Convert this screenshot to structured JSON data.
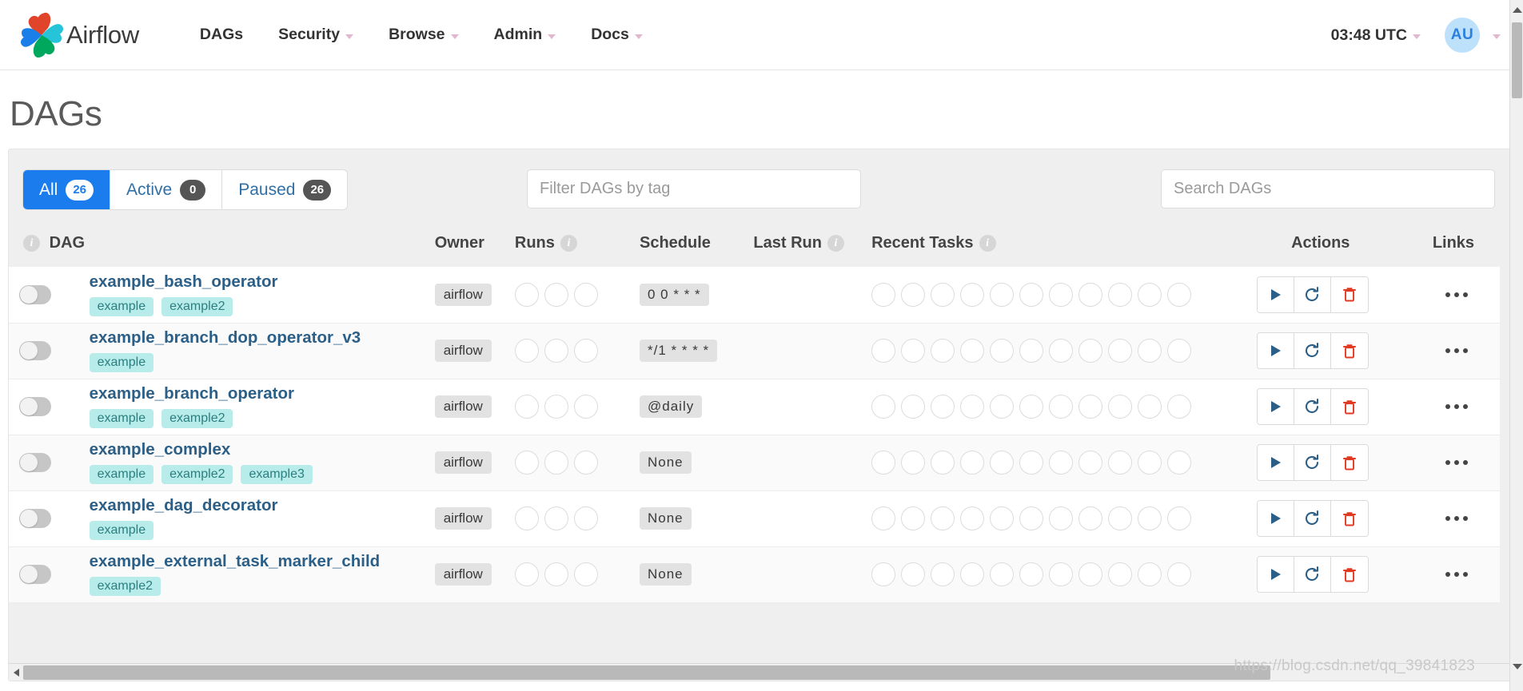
{
  "navbar": {
    "brand": "Airflow",
    "items": [
      {
        "label": "DAGs",
        "has_caret": false
      },
      {
        "label": "Security",
        "has_caret": true
      },
      {
        "label": "Browse",
        "has_caret": true
      },
      {
        "label": "Admin",
        "has_caret": true
      },
      {
        "label": "Docs",
        "has_caret": true
      }
    ],
    "clock": "03:48 UTC",
    "avatar_initials": "AU"
  },
  "page": {
    "title": "DAGs"
  },
  "tabs": [
    {
      "label": "All",
      "count": "26",
      "active": true
    },
    {
      "label": "Active",
      "count": "0",
      "active": false
    },
    {
      "label": "Paused",
      "count": "26",
      "active": false
    }
  ],
  "filters": {
    "tag_placeholder": "Filter DAGs by tag",
    "tag_value": "",
    "search_placeholder": "Search DAGs",
    "search_value": ""
  },
  "table": {
    "headers": {
      "toggle": "",
      "dag": "DAG",
      "owner": "Owner",
      "runs": "Runs",
      "schedule": "Schedule",
      "last_run": "Last Run",
      "recent_tasks": "Recent Tasks",
      "actions": "Actions",
      "links": "Links"
    },
    "rows": [
      {
        "name": "example_bash_operator",
        "tags": [
          "example",
          "example2"
        ],
        "owner": "airflow",
        "runs": 3,
        "schedule": "0 0 * * *",
        "last_run": "",
        "recent_tasks": 11,
        "paused": true
      },
      {
        "name": "example_branch_dop_operator_v3",
        "tags": [
          "example"
        ],
        "owner": "airflow",
        "runs": 3,
        "schedule": "*/1 * * * *",
        "last_run": "",
        "recent_tasks": 11,
        "paused": true
      },
      {
        "name": "example_branch_operator",
        "tags": [
          "example",
          "example2"
        ],
        "owner": "airflow",
        "runs": 3,
        "schedule": "@daily",
        "last_run": "",
        "recent_tasks": 11,
        "paused": true
      },
      {
        "name": "example_complex",
        "tags": [
          "example",
          "example2",
          "example3"
        ],
        "owner": "airflow",
        "runs": 3,
        "schedule": "None",
        "last_run": "",
        "recent_tasks": 11,
        "paused": true
      },
      {
        "name": "example_dag_decorator",
        "tags": [
          "example"
        ],
        "owner": "airflow",
        "runs": 3,
        "schedule": "None",
        "last_run": "",
        "recent_tasks": 11,
        "paused": true
      },
      {
        "name": "example_external_task_marker_child",
        "tags": [
          "example2"
        ],
        "owner": "airflow",
        "runs": 3,
        "schedule": "None",
        "last_run": "",
        "recent_tasks": 11,
        "paused": true
      }
    ],
    "action_icons": [
      "trigger-dag-play-icon",
      "refresh-icon",
      "delete-trash-icon"
    ],
    "links_icon": "ellipsis-icon"
  },
  "colors": {
    "accent_blue": "#1b7ded",
    "dag_link": "#2b5f88",
    "tag_bg": "#b8ecea",
    "tag_text": "#2b7f80",
    "danger_red": "#e03a22",
    "badge_dark": "#555555"
  },
  "watermark": "https://blog.csdn.net/qq_39841823"
}
